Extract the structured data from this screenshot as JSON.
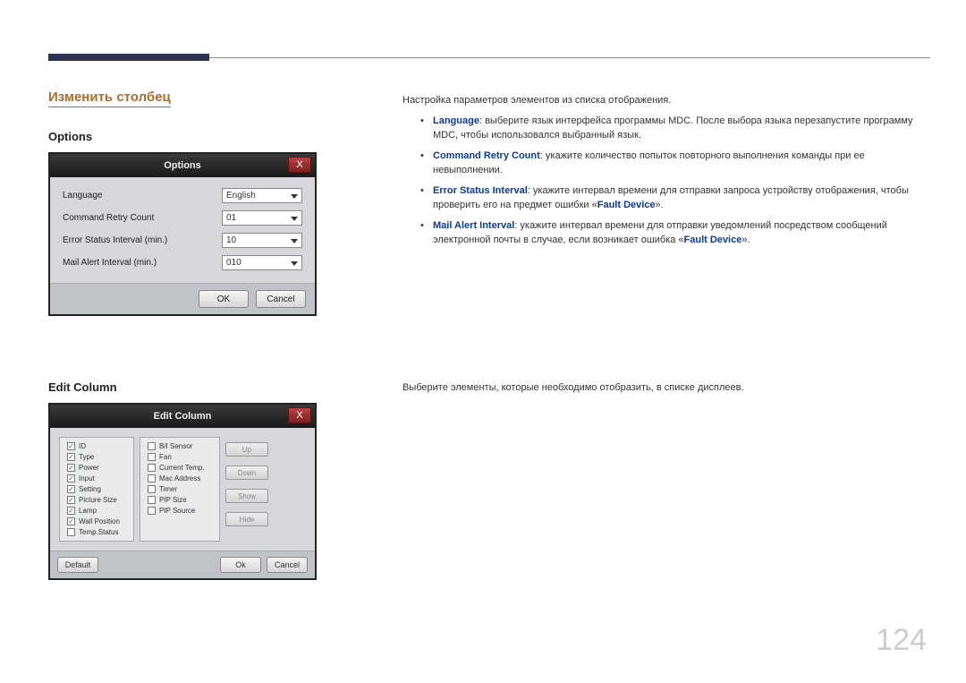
{
  "page_number": "124",
  "section_title": "Изменить столбец",
  "options": {
    "heading": "Options",
    "intro": "Настройка параметров элементов из списка отображения.",
    "items": [
      {
        "term": "Language",
        "text": ": выберите язык интерфейса программы MDC. После выбора языка перезапустите программу MDC, чтобы использовался выбранный язык."
      },
      {
        "term": "Command Retry Count",
        "text": ": укажите количество попыток повторного выполнения команды при ее невыполнении."
      },
      {
        "term": "Error Status Interval",
        "text": ": укажите интервал времени для отправки запроса устройству отображения, чтобы проверить его на предмет ошибки «",
        "link": "Fault Device",
        "tail": "»."
      },
      {
        "term": "Mail Alert Interval",
        "text": ": укажите интервал времени для отправки уведомлений посредством сообщений электронной почты в случае, если возникает ошибка «",
        "link": "Fault Device",
        "tail": "»."
      }
    ],
    "dialog": {
      "title": "Options",
      "rows": [
        {
          "label": "Language",
          "value": "English"
        },
        {
          "label": "Command Retry Count",
          "value": "01"
        },
        {
          "label": "Error Status Interval (min.)",
          "value": "10"
        },
        {
          "label": "Mail Alert Interval (min.)",
          "value": "010"
        }
      ],
      "ok": "OK",
      "cancel": "Cancel"
    }
  },
  "edit_column": {
    "heading": "Edit Column",
    "desc": "Выберите элементы, которые необходимо отобразить, в списке дисплеев.",
    "dialog": {
      "title": "Edit Column",
      "col1": [
        {
          "label": "ID",
          "checked": true
        },
        {
          "label": "Type",
          "checked": true
        },
        {
          "label": "Power",
          "checked": true
        },
        {
          "label": "Input",
          "checked": true
        },
        {
          "label": "Setting",
          "checked": true
        },
        {
          "label": "Picture Size",
          "checked": true
        },
        {
          "label": "Lamp",
          "checked": true
        },
        {
          "label": "Wall Position",
          "checked": true
        },
        {
          "label": "Temp.Status",
          "checked": false
        }
      ],
      "col2": [
        {
          "label": "B/I Sensor",
          "checked": false
        },
        {
          "label": "Fan",
          "checked": false
        },
        {
          "label": "Current Temp.",
          "checked": false
        },
        {
          "label": "Mac Address",
          "checked": false
        },
        {
          "label": "Timer",
          "checked": false
        },
        {
          "label": "PIP Size",
          "checked": false
        },
        {
          "label": "PIP Source",
          "checked": false
        }
      ],
      "side": [
        "Up",
        "Down",
        "Show",
        "Hide"
      ],
      "default": "Default",
      "ok": "Ok",
      "cancel": "Cancel"
    }
  }
}
